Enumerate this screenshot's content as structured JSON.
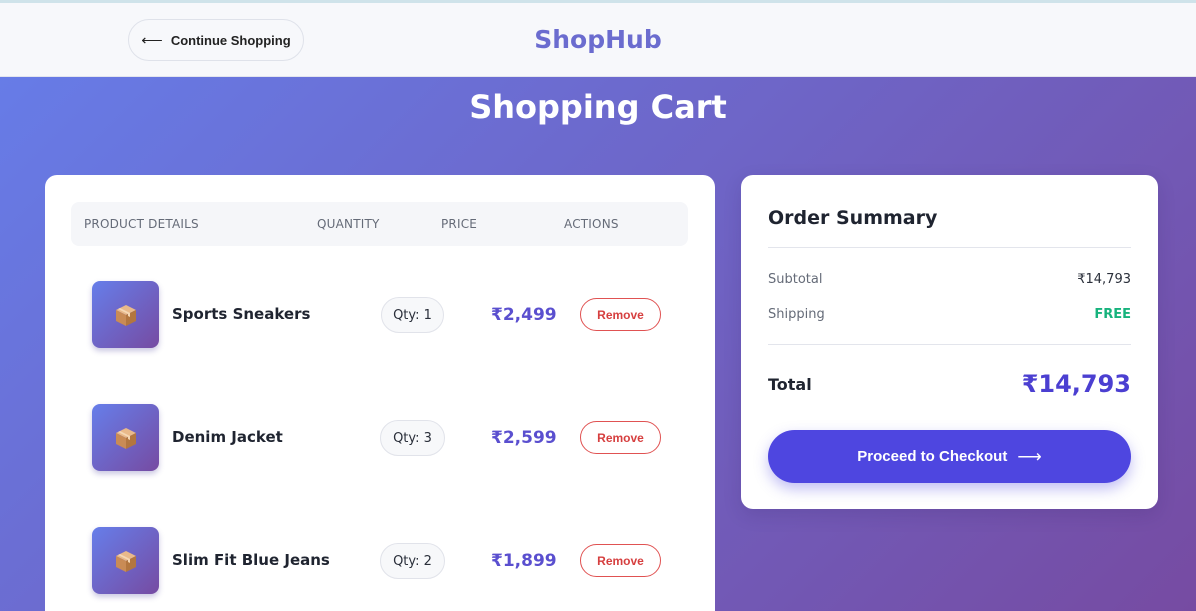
{
  "header": {
    "continue_label": "Continue Shopping",
    "back_icon": "arrow-left-icon",
    "brand": "ShopHub"
  },
  "page": {
    "title": "Shopping Cart"
  },
  "cart": {
    "columns": [
      "PRODUCT DETAILS",
      "QUANTITY",
      "PRICE",
      "ACTIONS"
    ],
    "items": [
      {
        "icon": "package-icon",
        "name": "Sports Sneakers",
        "qty": "Qty: 1",
        "price": "₹2,499",
        "remove_label": "Remove"
      },
      {
        "icon": "package-icon",
        "name": "Denim Jacket",
        "qty": "Qty: 3",
        "price": "₹2,599",
        "remove_label": "Remove"
      },
      {
        "icon": "package-icon",
        "name": "Slim Fit Blue Jeans",
        "qty": "Qty: 2",
        "price": "₹1,899",
        "remove_label": "Remove"
      }
    ]
  },
  "summary": {
    "title": "Order Summary",
    "subtotal_label": "Subtotal",
    "subtotal_value": "₹14,793",
    "shipping_label": "Shipping",
    "shipping_value": "FREE",
    "total_label": "Total",
    "total_value": "₹14,793",
    "checkout_label": "Proceed to Checkout",
    "checkout_icon": "arrow-right-icon"
  },
  "colors": {
    "gradient_start": "#667eea",
    "gradient_end": "#764ba2",
    "accent": "#4e46e0",
    "price": "#5a4fcf",
    "remove": "#d63f3f",
    "free": "#17b37d",
    "brand": "#6b6ccf"
  }
}
